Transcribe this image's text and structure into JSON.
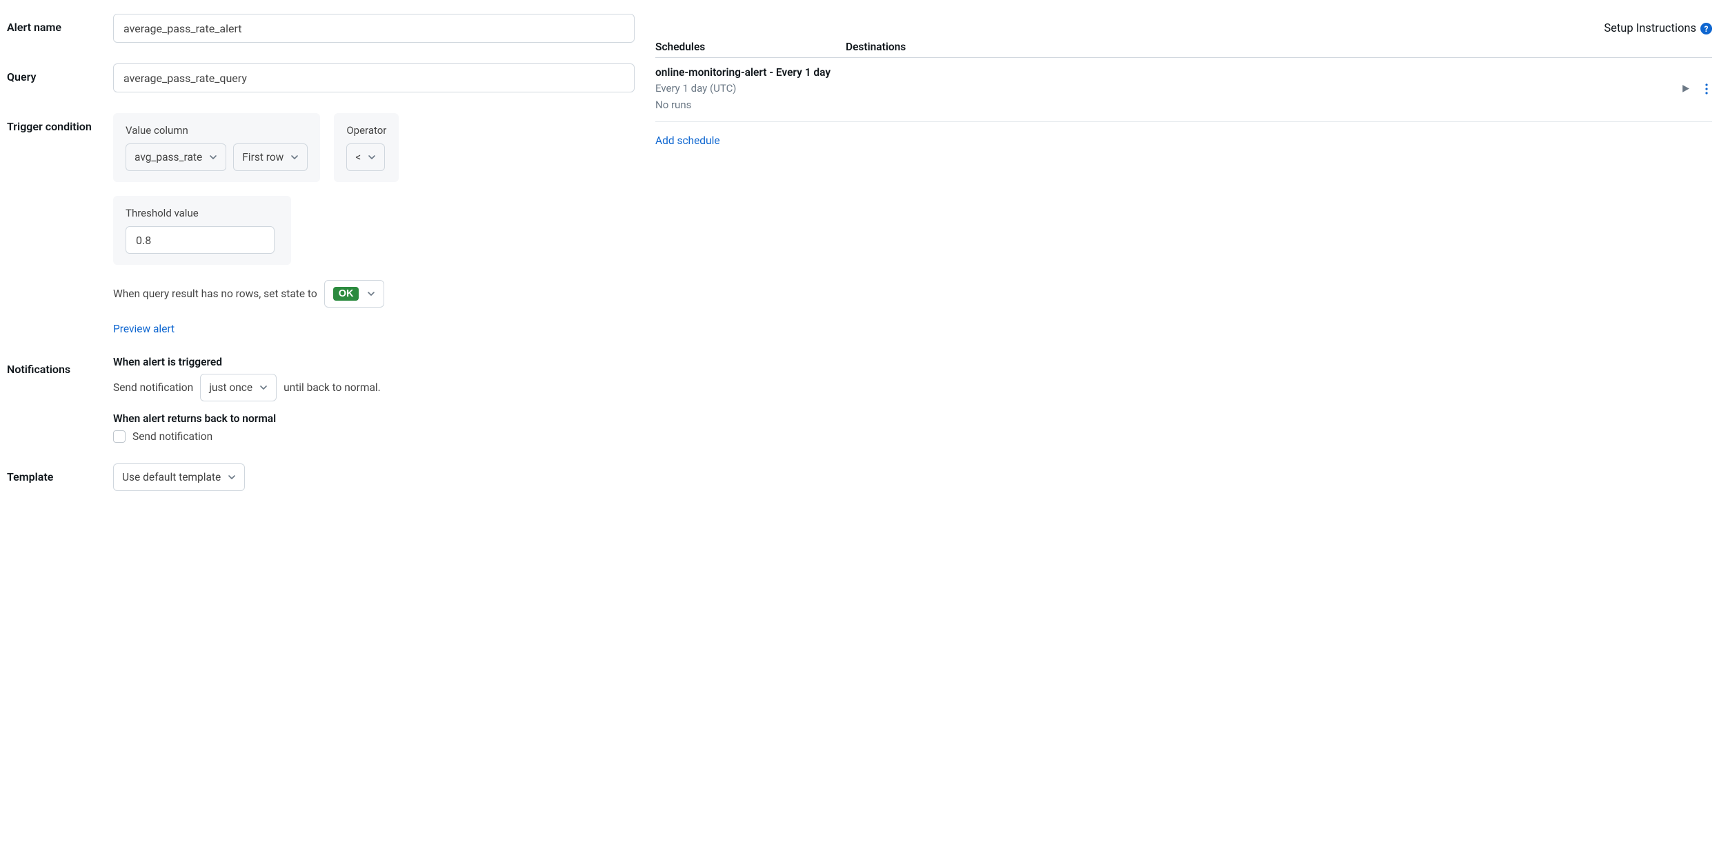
{
  "form": {
    "alert_name": {
      "label": "Alert name",
      "value": "average_pass_rate_alert"
    },
    "query": {
      "label": "Query",
      "value": "average_pass_rate_query"
    },
    "trigger": {
      "label": "Trigger condition",
      "value_column_label": "Value column",
      "value_column": "avg_pass_rate",
      "row_select": "First row",
      "operator_label": "Operator",
      "operator": "<",
      "threshold_label": "Threshold value",
      "threshold_value": "0.8",
      "no_rows_text": "When query result has no rows, set state to",
      "no_rows_state": "OK",
      "preview_link": "Preview alert"
    },
    "notifications": {
      "label": "Notifications",
      "triggered_heading": "When alert is triggered",
      "send_text_pre": "Send notification",
      "frequency": "just once",
      "send_text_post": "until back to normal.",
      "normal_heading": "When alert returns back to normal",
      "normal_checkbox_label": "Send notification"
    },
    "template": {
      "label": "Template",
      "value": "Use default template"
    }
  },
  "side": {
    "setup_link": "Setup Instructions",
    "schedules_header": "Schedules",
    "destinations_header": "Destinations",
    "schedule_item": {
      "title": "online-monitoring-alert - Every 1 day",
      "interval": "Every 1 day (UTC)",
      "runs": "No runs"
    },
    "add_schedule": "Add schedule"
  }
}
